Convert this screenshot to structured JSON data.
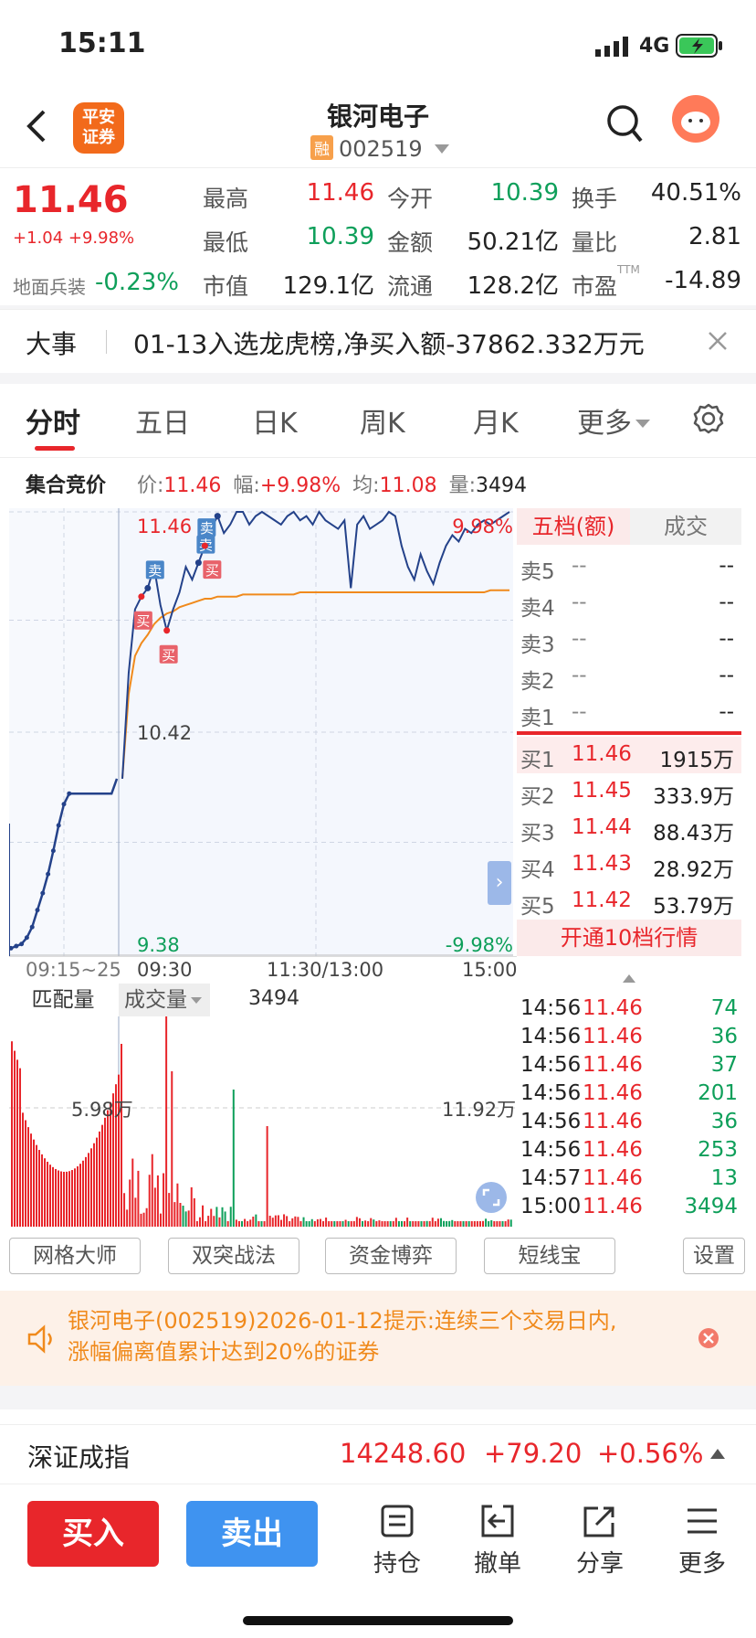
{
  "status_bar": {
    "time": "15:11",
    "network": "4G"
  },
  "header": {
    "logo_text": "平安\n证券",
    "title": "银河电子",
    "badge": "融",
    "code": "002519"
  },
  "quote": {
    "price": "11.46",
    "change": "+1.04 +9.98%",
    "sector_label": "地面兵装",
    "sector_change": "-0.23%",
    "rows": [
      [
        {
          "label": "最高",
          "value": "11.46",
          "color": "red"
        },
        {
          "label": "今开",
          "value": "10.39",
          "color": "green"
        },
        {
          "label": "换手",
          "value": "40.51%",
          "color": "black"
        }
      ],
      [
        {
          "label": "最低",
          "value": "10.39",
          "color": "green"
        },
        {
          "label": "金额",
          "value": "50.21亿",
          "color": "black"
        },
        {
          "label": "量比",
          "value": "2.81",
          "color": "black"
        }
      ],
      [
        {
          "label": "市值",
          "value": "129.1亿",
          "color": "black"
        },
        {
          "label": "流通",
          "value": "128.2亿",
          "color": "black"
        },
        {
          "label": "市盈",
          "value": "-14.89",
          "color": "black",
          "sup": "TTM"
        }
      ]
    ]
  },
  "news": {
    "label": "大事",
    "text": "01-13入选龙虎榜,净买入额-37862.332万元"
  },
  "tabs": [
    "分时",
    "五日",
    "日K",
    "周K",
    "月K",
    "更多"
  ],
  "info": {
    "title": "集合竞价",
    "price_label": "价:",
    "price": "11.46",
    "range_label": "幅:",
    "range": "+9.98%",
    "avg_label": "均:",
    "avg": "11.08",
    "vol_label": "量:",
    "vol": "3494"
  },
  "chart_data": {
    "type": "line",
    "price_top": "11.46",
    "price_mid": "10.42",
    "price_bottom": "9.38",
    "pct_top": "9.98%",
    "pct_bottom": "-9.98%",
    "x_labels": [
      "09:15~25",
      "09:30",
      "11:30/13:00",
      "15:00"
    ],
    "ylim": [
      9.38,
      11.46
    ],
    "auction_series": [
      9.4,
      9.41,
      9.42,
      9.45,
      9.5,
      9.58,
      9.66,
      9.75,
      9.86,
      9.98,
      10.08,
      10.13,
      10.13,
      10.13,
      10.13,
      10.13,
      10.13,
      10.13,
      10.13,
      10.13,
      10.2
    ],
    "price_series": [
      10.2,
      10.7,
      11.0,
      11.06,
      11.1,
      11.2,
      11.02,
      10.9,
      11.0,
      11.08,
      11.2,
      11.14,
      11.22,
      11.3,
      11.38,
      11.44,
      11.36,
      11.4,
      11.46,
      11.46,
      11.4,
      11.44,
      11.46,
      11.44,
      11.42,
      11.4,
      11.44,
      11.46,
      11.42,
      11.44,
      11.4,
      11.46,
      11.42,
      11.4,
      11.38,
      11.42,
      11.1,
      11.4,
      11.44,
      11.38,
      11.4,
      11.42,
      11.46,
      11.44,
      11.3,
      11.2,
      11.14,
      11.26,
      11.18,
      11.12,
      11.22,
      11.3,
      11.35,
      11.32,
      11.38,
      11.36,
      11.4,
      11.42,
      11.4,
      11.42,
      11.44,
      11.46
    ],
    "avg_series": [
      10.2,
      10.6,
      10.78,
      10.84,
      10.88,
      10.93,
      10.96,
      10.98,
      10.99,
      11.01,
      11.02,
      11.03,
      11.04,
      11.05,
      11.05,
      11.06,
      11.06,
      11.06,
      11.06,
      11.07,
      11.07,
      11.07,
      11.07,
      11.07,
      11.07,
      11.07,
      11.07,
      11.07,
      11.08,
      11.08,
      11.08,
      11.08,
      11.08,
      11.08,
      11.08,
      11.08,
      11.08,
      11.08,
      11.08,
      11.08,
      11.08,
      11.08,
      11.08,
      11.08,
      11.08,
      11.08,
      11.08,
      11.08,
      11.08,
      11.08,
      11.08,
      11.08,
      11.08,
      11.08,
      11.08,
      11.08,
      11.08,
      11.08,
      11.09,
      11.09,
      11.09,
      11.09
    ],
    "markers": [
      {
        "label": "买",
        "type": "buy",
        "idx": 3
      },
      {
        "label": "卖",
        "type": "sell",
        "idx": 4
      },
      {
        "label": "买",
        "type": "buy",
        "idx": 7
      },
      {
        "label": "卖",
        "type": "sell",
        "idx": 12
      },
      {
        "label": "卖",
        "type": "sell",
        "idx": 13
      },
      {
        "label": "买",
        "type": "buy",
        "idx": 13
      },
      {
        "label": "卖",
        "type": "sell",
        "idx": 15
      }
    ]
  },
  "volume": {
    "tab1": "匹配量",
    "tab2": "成交量",
    "value": "3494",
    "left_label": "5.98万",
    "right_label": "11.92万"
  },
  "book": {
    "tab_active": "五档(额)",
    "tab_other": "成交",
    "asks": [
      {
        "label": "卖5",
        "price": "--",
        "amount": "--"
      },
      {
        "label": "卖4",
        "price": "--",
        "amount": "--"
      },
      {
        "label": "卖3",
        "price": "--",
        "amount": "--"
      },
      {
        "label": "卖2",
        "price": "--",
        "amount": "--"
      },
      {
        "label": "卖1",
        "price": "--",
        "amount": "--"
      }
    ],
    "bids": [
      {
        "label": "买1",
        "price": "11.46",
        "amount": "1915万"
      },
      {
        "label": "买2",
        "price": "11.45",
        "amount": "333.9万"
      },
      {
        "label": "买3",
        "price": "11.44",
        "amount": "88.43万"
      },
      {
        "label": "买4",
        "price": "11.43",
        "amount": "28.92万"
      },
      {
        "label": "买5",
        "price": "11.42",
        "amount": "53.79万"
      }
    ],
    "open_ten": "开通10档行情"
  },
  "trades": [
    {
      "time": "14:56",
      "price": "11.46",
      "vol": "74"
    },
    {
      "time": "14:56",
      "price": "11.46",
      "vol": "36"
    },
    {
      "time": "14:56",
      "price": "11.46",
      "vol": "37"
    },
    {
      "time": "14:56",
      "price": "11.46",
      "vol": "201"
    },
    {
      "time": "14:56",
      "price": "11.46",
      "vol": "36"
    },
    {
      "time": "14:56",
      "price": "11.46",
      "vol": "253"
    },
    {
      "time": "14:57",
      "price": "11.46",
      "vol": "13"
    },
    {
      "time": "15:00",
      "price": "11.46",
      "vol": "3494"
    }
  ],
  "tools": [
    "网格大师",
    "双突战法",
    "资金博弈",
    "短线宝",
    "设置"
  ],
  "notice": {
    "text1": "银河电子(002519)2026-01-12提示:连续三个交易日内,",
    "text2": "涨幅偏离值累计达到20%的证券"
  },
  "index": {
    "name": "深证成指",
    "value": "14248.60",
    "change": "+79.20",
    "pct": "+0.56%"
  },
  "bottom": {
    "buy": "买入",
    "sell": "卖出",
    "items": [
      "持仓",
      "撤单",
      "分享",
      "更多"
    ]
  },
  "colors": {
    "red": "#e8262b",
    "green": "#0e9f5a",
    "blue_line": "#24428a",
    "avg_line": "#f08a1c",
    "sell_btn": "#3f93f0"
  }
}
